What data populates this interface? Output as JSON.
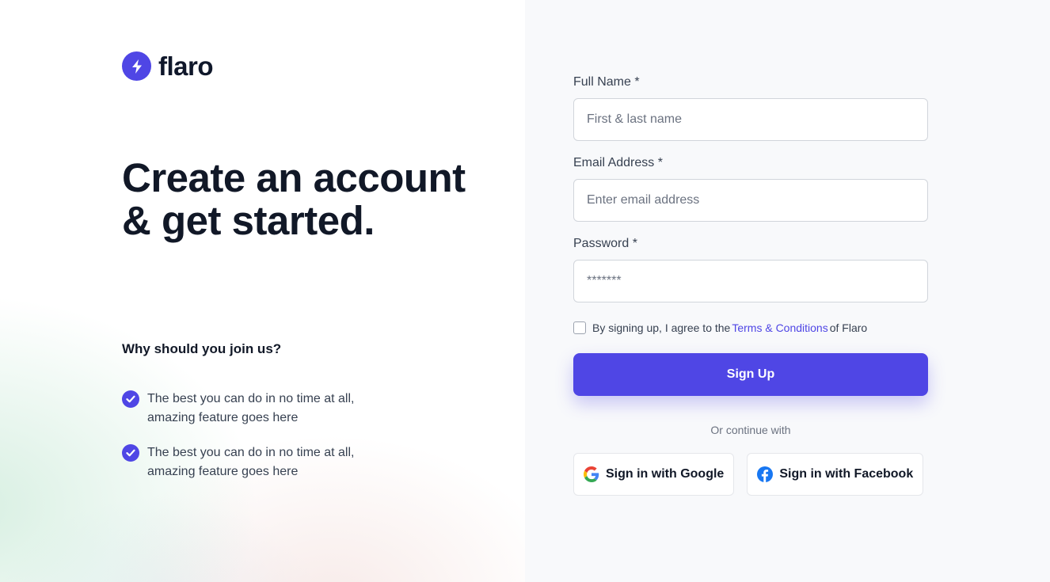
{
  "brand": {
    "name": "flaro",
    "accent_color": "#4f46e5"
  },
  "hero": {
    "headline": "Create an account & get started.",
    "why_title": "Why should you join us?",
    "features": [
      "The best you can do in no time at all, amazing feature goes here",
      "The best you can do in no time at all, amazing feature goes here"
    ]
  },
  "form": {
    "full_name": {
      "label": "Full Name *",
      "placeholder": "First & last name"
    },
    "email": {
      "label": "Email Address *",
      "placeholder": "Enter email address"
    },
    "password": {
      "label": "Password *",
      "placeholder": "*******"
    },
    "terms": {
      "prefix": "By signing up, I agree to the",
      "link": "Terms & Conditions",
      "suffix": "of Flaro",
      "checked": false
    },
    "submit_label": "Sign Up",
    "divider": "Or continue with",
    "google_label": "Sign in with Google",
    "facebook_label": "Sign in with Facebook"
  },
  "icons": {
    "logo": "lightning-bolt-icon",
    "feature_check": "check-circle-icon",
    "google": "google-icon",
    "facebook": "facebook-icon"
  }
}
